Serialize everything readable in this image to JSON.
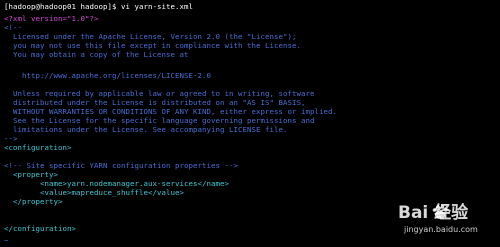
{
  "prompt": "[hadoop@hadoop01 hadoop]$ vi yarn-site.xml",
  "lines": {
    "l1": "<?xml version=\"1.0\"?>",
    "l2": "<!--",
    "l3": "  Licensed under the Apache License, Version 2.0 (the \"License\");",
    "l4": "  you may not use this file except in compliance with the License.",
    "l5": "  You may obtain a copy of the License at",
    "l6": "",
    "l7": "    http://www.apache.org/licenses/LICENSE-2.0",
    "l8": "",
    "l9": "  Unless required by applicable law or agreed to in writing, software",
    "l10": "  distributed under the License is distributed on an \"AS IS\" BASIS,",
    "l11": "  WITHOUT WARRANTIES OR CONDITIONS OF ANY KIND, either express or implied.",
    "l12": "  See the License for the specific language governing permissions and",
    "l13": "  limitations under the License. See accompanying LICENSE file.",
    "l14": "-->",
    "l15": "<configuration>",
    "l16": "",
    "l17": "<!-- Site specific YARN configuration properties -->",
    "l18": "  <property>",
    "l19": "        <name>yarn.nodemanager.aux-services</name>",
    "l20": "        <value>mapreduce_shuffle</value>",
    "l21": "  </property>",
    "l22": "",
    "l23": "",
    "l24": "</configuration>",
    "tilde": "~"
  },
  "watermark": {
    "logo_text": "Bai 经验",
    "url": "jingyan.baidu.com",
    "icon": "baidu-paw-icon"
  },
  "colors": {
    "background": "#000000",
    "comment": "#4a6fd6",
    "declaration": "#d64bd6",
    "tag": "#3ec9d6",
    "text": "#ffffff"
  }
}
